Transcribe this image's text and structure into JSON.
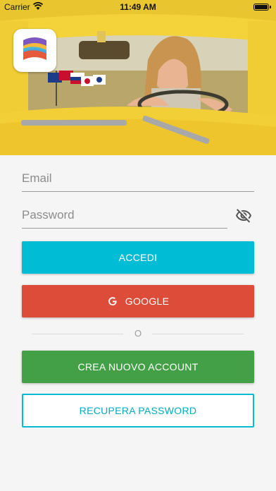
{
  "status_bar": {
    "carrier": "Carrier",
    "time": "11:49 AM"
  },
  "form": {
    "email_placeholder": "Email",
    "password_placeholder": "Password"
  },
  "buttons": {
    "login": "ACCEDI",
    "google": "GOOGLE",
    "divider_text": "O",
    "create_account": "CREA NUOVO ACCOUNT",
    "recover_password": "RECUPERA PASSWORD"
  },
  "icons": {
    "wifi": "wifi-icon",
    "battery": "battery-icon",
    "logo": "app-logo",
    "visibility": "visibility-off-icon",
    "google": "google-g-icon"
  },
  "colors": {
    "login": "#00bcd4",
    "google": "#dd4b39",
    "create": "#43a047",
    "recover_border": "#00bcd4"
  }
}
